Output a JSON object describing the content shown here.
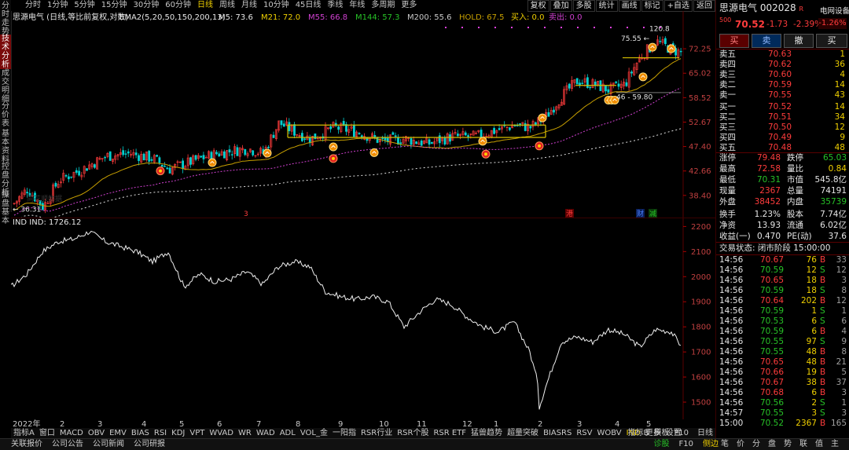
{
  "left_tabs": [
    "分时走势",
    "技术分析",
    "成交明细",
    "分价表",
    "基本资料",
    "控盘分析",
    "操盘基本"
  ],
  "periods": [
    "分时",
    "1分钟",
    "5分钟",
    "15分钟",
    "30分钟",
    "60分钟",
    "日线",
    "周线",
    "月线",
    "10分钟",
    "45日线",
    "季线",
    "年线",
    "多周期",
    "更多"
  ],
  "selected_period": "日线",
  "right_tools": [
    "复权",
    "叠加",
    "多股",
    "统计",
    "画线",
    "标记",
    "+自选",
    "返回"
  ],
  "chart_title": "思源电气 (日线,等比前复权,对数)",
  "ema_label": "EMA2(5,20,50,150,200,13)",
  "ma_legend": [
    {
      "label": "M5: 73.6",
      "color": "#e6e6e6"
    },
    {
      "label": "M21: 72.0",
      "color": "#f0d000"
    },
    {
      "label": "M55: 66.8",
      "color": "#d040d0"
    },
    {
      "label": "M144: 57.3",
      "color": "#27c227"
    },
    {
      "label": "M200: 55.6",
      "color": "#c8c8c8"
    },
    {
      "label": "HOLD: 67.5",
      "color": "#c8a000"
    },
    {
      "label": "买入: 0.0",
      "color": "#f0d000"
    },
    {
      "label": "卖出: 0.0",
      "color": "#d040d0"
    }
  ],
  "price_ticks": [
    "72.25",
    "65.02",
    "58.52",
    "52.67",
    "47.40",
    "42.66",
    "38.40"
  ],
  "price_annotations": {
    "high": "75.55",
    "peak": "120.8",
    "low": "36.31",
    "range": "46 - 59.80"
  },
  "event_marks": [
    "港",
    "财",
    "减"
  ],
  "indicator_title": "IND  IND: 1726.12",
  "ind_ticks": [
    "2200",
    "2100",
    "2000",
    "1900",
    "1800",
    "1700",
    "1600",
    "1500"
  ],
  "month_labels": [
    "2022年",
    "2",
    "3",
    "4",
    "5",
    "6",
    "7",
    "8",
    "9",
    "10",
    "11",
    "12",
    "1",
    "2",
    "3",
    "4",
    "5"
  ],
  "indicator_tabs": [
    "指标A",
    "窗口",
    "MACD",
    "OBV",
    "EMV",
    "BIAS",
    "RSI",
    "KDJ",
    "VPT",
    "WVAD",
    "WR",
    "WAD",
    "ADL",
    "VOL_金",
    "一阳指",
    "RSR行业",
    "RSR个股",
    "RSR ETF",
    "猛兽趋势",
    "超量突破",
    "BIASRS",
    "RSV",
    "WOBV",
    "IND",
    "更多",
    "设置"
  ],
  "selected_indicator": "IND",
  "indicator_right_tabs": [
    "指标B",
    "模板",
    "F10"
  ],
  "status_left": [
    "关联报价",
    "公司公告",
    "公司新闻",
    "公司研报"
  ],
  "status_right": [
    "诊股",
    "F10",
    "侧边"
  ],
  "side_tab": "日线",
  "watermark": "同花顺数据",
  "stock": {
    "name": "思源电气",
    "code": "002028",
    "badge": "R 500",
    "industry": "电网设备",
    "industry_change": "-1.26%",
    "price": "70.52",
    "change": "-1.73",
    "change_pct": "-2.39%"
  },
  "trade_buttons": [
    "买",
    "卖",
    "撤",
    "买"
  ],
  "asks": [
    {
      "label": "卖五",
      "price": "70.63",
      "vol": "1"
    },
    {
      "label": "卖四",
      "price": "70.62",
      "vol": "36"
    },
    {
      "label": "卖三",
      "price": "70.60",
      "vol": "4"
    },
    {
      "label": "卖二",
      "price": "70.59",
      "vol": "14"
    },
    {
      "label": "卖一",
      "price": "70.55",
      "vol": "43"
    }
  ],
  "bids": [
    {
      "label": "买一",
      "price": "70.52",
      "vol": "14"
    },
    {
      "label": "买二",
      "price": "70.51",
      "vol": "34"
    },
    {
      "label": "买三",
      "price": "70.50",
      "vol": "12"
    },
    {
      "label": "买四",
      "price": "70.49",
      "vol": "9"
    },
    {
      "label": "买五",
      "price": "70.48",
      "vol": "48"
    }
  ],
  "stats": [
    {
      "l1": "涨停",
      "v1": "79.48",
      "c1": "red",
      "l2": "跌停",
      "v2": "65.03",
      "c2": "green"
    },
    {
      "l1": "最高",
      "v1": "72.58",
      "c1": "red",
      "l2": "量比",
      "v2": "0.84",
      "c2": "yellow"
    },
    {
      "l1": "最低",
      "v1": "70.31",
      "c1": "green",
      "l2": "市值",
      "v2": "545.8亿",
      "c2": "white"
    },
    {
      "l1": "现量",
      "v1": "2367",
      "c1": "red",
      "l2": "总量",
      "v2": "74191",
      "c2": "white"
    },
    {
      "l1": "外盘",
      "v1": "38452",
      "c1": "red",
      "l2": "内盘",
      "v2": "35739",
      "c2": "green"
    },
    {
      "l1": "换手",
      "v1": "1.23%",
      "c1": "white",
      "l2": "股本",
      "v2": "7.74亿",
      "c2": "white"
    },
    {
      "l1": "净资",
      "v1": "13.93",
      "c1": "white",
      "l2": "流通",
      "v2": "6.02亿",
      "c2": "white"
    },
    {
      "l1": "收益(一)",
      "v1": "0.470",
      "c1": "white",
      "l2": "PE(动)",
      "v2": "37.6",
      "c2": "white"
    }
  ],
  "trade_status": "交易状态: 闭市阶段 15:00:00",
  "ticks": [
    {
      "t": "14:56",
      "p": "70.67",
      "v": "76",
      "s": "B",
      "n": "33"
    },
    {
      "t": "14:56",
      "p": "70.59",
      "v": "12",
      "s": "S",
      "n": "12"
    },
    {
      "t": "14:56",
      "p": "70.65",
      "v": "18",
      "s": "B",
      "n": "3"
    },
    {
      "t": "14:56",
      "p": "70.59",
      "v": "18",
      "s": "S",
      "n": "8"
    },
    {
      "t": "14:56",
      "p": "70.64",
      "v": "202",
      "s": "B",
      "n": "12"
    },
    {
      "t": "14:56",
      "p": "70.59",
      "v": "1",
      "s": "S",
      "n": "1"
    },
    {
      "t": "14:56",
      "p": "70.53",
      "v": "6",
      "s": "S",
      "n": "6"
    },
    {
      "t": "14:56",
      "p": "70.59",
      "v": "6",
      "s": "B",
      "n": "4"
    },
    {
      "t": "14:56",
      "p": "70.55",
      "v": "97",
      "s": "S",
      "n": "9"
    },
    {
      "t": "14:56",
      "p": "70.55",
      "v": "48",
      "s": "B",
      "n": "8"
    },
    {
      "t": "14:56",
      "p": "70.65",
      "v": "48",
      "s": "B",
      "n": "21"
    },
    {
      "t": "14:56",
      "p": "70.66",
      "v": "19",
      "s": "B",
      "n": "5"
    },
    {
      "t": "14:56",
      "p": "70.67",
      "v": "38",
      "s": "B",
      "n": "37"
    },
    {
      "t": "14:56",
      "p": "70.68",
      "v": "6",
      "s": "B",
      "n": "3"
    },
    {
      "t": "14:56",
      "p": "70.56",
      "v": "2",
      "s": "S",
      "n": "1"
    },
    {
      "t": "14:57",
      "p": "70.55",
      "v": "3",
      "s": "S",
      "n": "3"
    },
    {
      "t": "15:00",
      "p": "70.52",
      "v": "2367",
      "s": "B",
      "n": "165"
    }
  ],
  "bottom_tabs": [
    "笔",
    "价",
    "分",
    "盘",
    "势",
    "联",
    "值",
    "主"
  ],
  "colors": {
    "up": "#ff3c3c",
    "down": "#27c227",
    "accent": "#f0d000",
    "bg": "#000000"
  }
}
